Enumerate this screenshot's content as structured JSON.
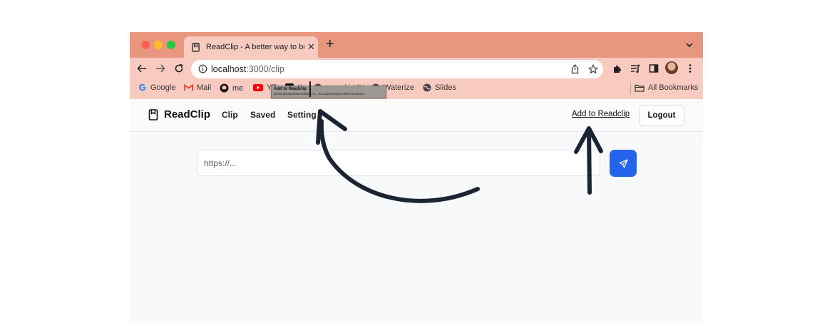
{
  "browser": {
    "tab_title": "ReadClip - A better way to bo",
    "url_host": "localhost",
    "url_path": ":3000/clip"
  },
  "bookmarks": [
    {
      "label": "Google",
      "icon": "google-icon"
    },
    {
      "label": "Mail",
      "icon": "gmail-icon"
    },
    {
      "label": "me",
      "icon": "github-icon"
    },
    {
      "label": "YT",
      "icon": "youtube-icon"
    },
    {
      "label": "X",
      "icon": "x-icon"
    },
    {
      "label": "ycombi HN",
      "icon": "globe-icon"
    },
    {
      "label": "Waterize",
      "icon": "globe-icon"
    },
    {
      "label": "Slides",
      "icon": "globe-icon"
    }
  ],
  "all_bookmarks_label": "All Bookmarks",
  "tooltip": {
    "title": "Add to Readclip",
    "url": "javascript:window.location=%...JComponent(document.location)"
  },
  "app": {
    "brand": "ReadClip",
    "nav": [
      "Clip",
      "Saved",
      "Setting"
    ],
    "add_link": "Add to Readclip",
    "logout": "Logout"
  },
  "clip_form": {
    "placeholder": "https://..."
  },
  "colors": {
    "tab_strip": "#e9967f",
    "toolbar": "#f7cbbf",
    "submit_button": "#2563eb",
    "arrow": "#1b2532"
  }
}
